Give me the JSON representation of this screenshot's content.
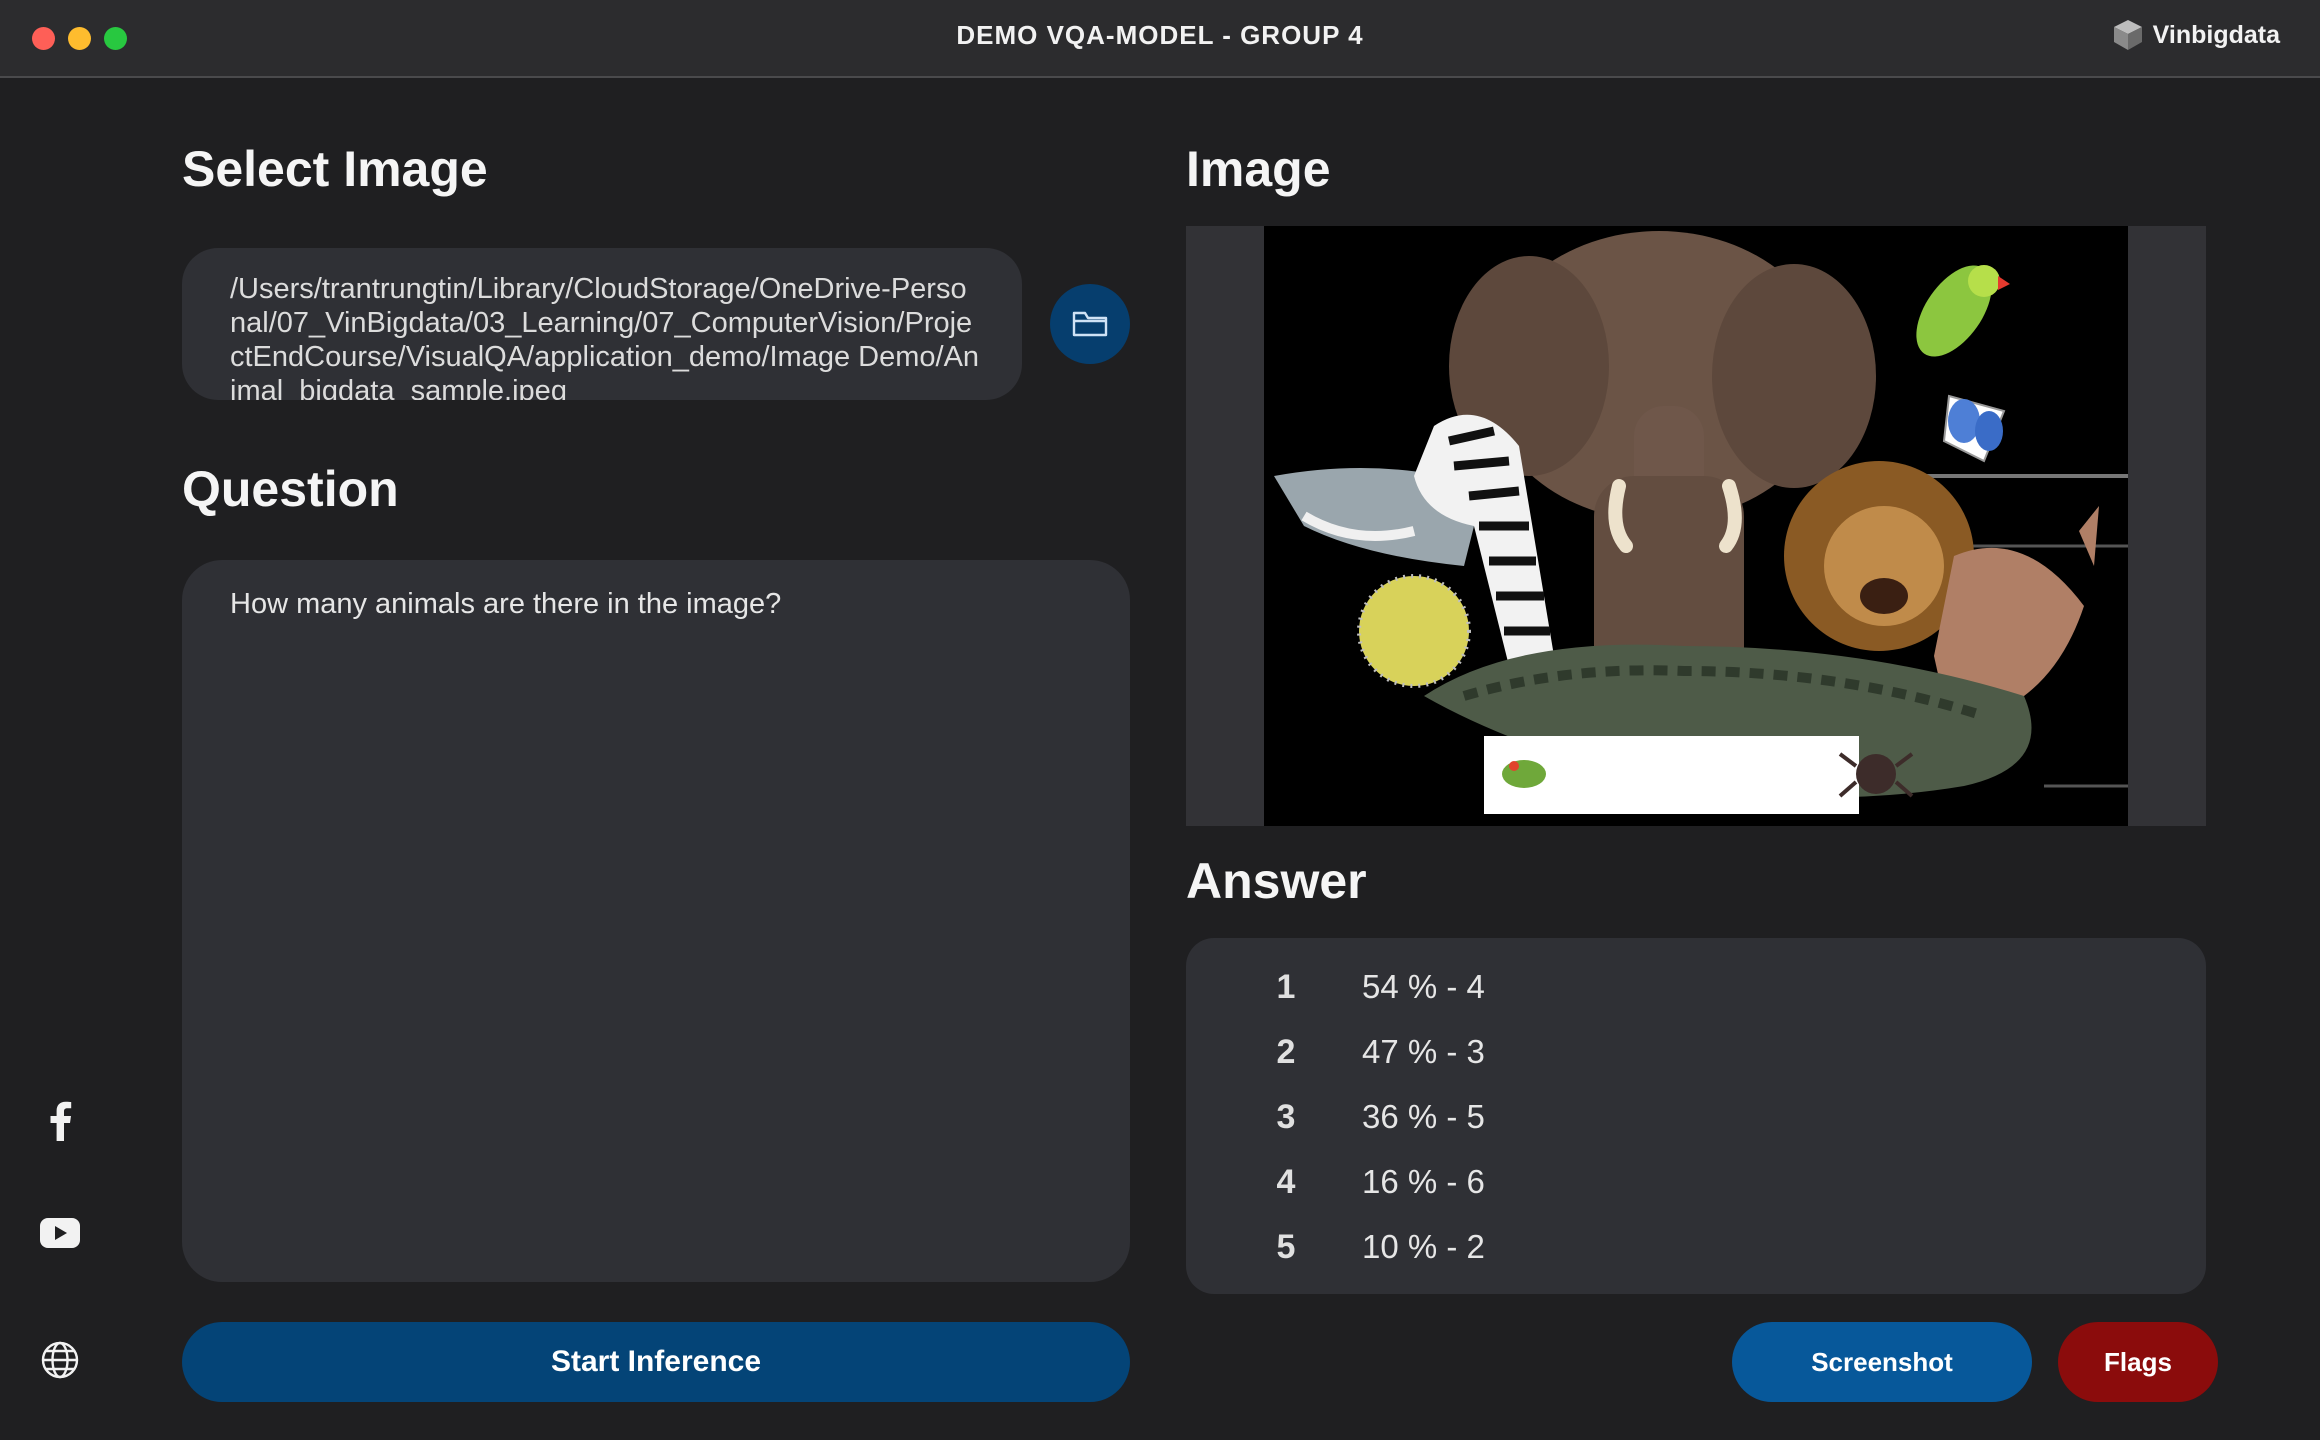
{
  "window": {
    "title": "DEMO VQA-MODEL - GROUP 4",
    "brand": "Vinbigdata"
  },
  "colors": {
    "background": "#1f1f21",
    "panel": "#2f3035",
    "primary_button": "#044477",
    "screenshot_button": "#07589a",
    "flags_button": "#8b0c0c"
  },
  "sidebar": {
    "icons": [
      "facebook-icon",
      "youtube-icon",
      "globe-icon"
    ]
  },
  "select_image": {
    "heading": "Select Image",
    "path": "/Users/trantrungtin/Library/CloudStorage/OneDrive-Personal/07_VinBigdata/03_Learning/07_ComputerVision/ProjectEndCourse/VisualQA/application_demo/Image Demo/Animal_bigdata_sample.jpeg",
    "browse_icon": "folder-icon"
  },
  "question": {
    "heading": "Question",
    "text": "How many animals are there in the image?"
  },
  "image": {
    "heading": "Image"
  },
  "answer": {
    "heading": "Answer",
    "items": [
      {
        "rank": "1",
        "value": "54 % - 4"
      },
      {
        "rank": "2",
        "value": "47 % - 3"
      },
      {
        "rank": "3",
        "value": "36 % - 5"
      },
      {
        "rank": "4",
        "value": "16 % - 6"
      },
      {
        "rank": "5",
        "value": "10 % - 2"
      }
    ]
  },
  "buttons": {
    "start": "Start Inference",
    "screenshot": "Screenshot",
    "flags": "Flags"
  }
}
